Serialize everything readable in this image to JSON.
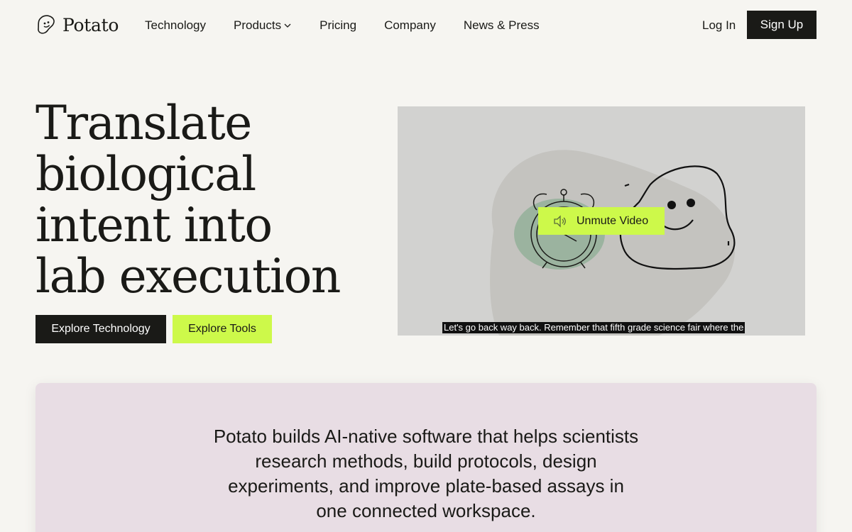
{
  "brand": {
    "name": "Potato",
    "logo_icon": "potato-face-icon"
  },
  "nav": {
    "items": [
      {
        "label": "Technology"
      },
      {
        "label": "Products",
        "icon": "chevron-down-icon"
      },
      {
        "label": "Pricing"
      },
      {
        "label": "Company"
      },
      {
        "label": "News & Press"
      }
    ],
    "login_label": "Log In",
    "signup_label": "Sign Up"
  },
  "hero": {
    "title_lines": [
      "Translate",
      "biological",
      "intent into",
      "lab execution"
    ],
    "cta_primary": "Explore Technology",
    "cta_secondary": "Explore Tools"
  },
  "video": {
    "unmute_label": "Unmute Video",
    "unmute_icon": "speaker-muted-icon",
    "caption": "Let's go back way back. Remember that fifth grade science fair where the"
  },
  "description": {
    "text": "Potato builds AI-native software that helps scientists research methods, build protocols, design experiments, and improve plate-based assays in one connected workspace."
  },
  "colors": {
    "background": "#f6f5f1",
    "ink": "#1a1a17",
    "accent_lime": "#cdf94a",
    "card_pink": "#e8dde4",
    "video_bg": "#d2d2d0"
  }
}
